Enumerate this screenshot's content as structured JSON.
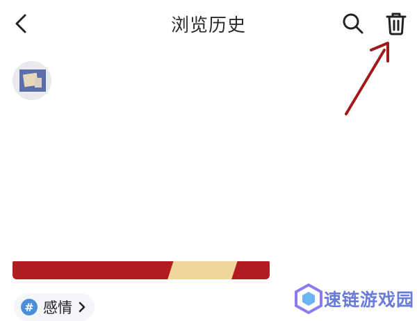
{
  "header": {
    "title": "浏览历史",
    "back_icon": "chevron-left-icon",
    "search_icon": "search-icon",
    "trash_icon": "trash-icon"
  },
  "feed": {
    "tag_label": "感情",
    "tag_symbol": "#"
  },
  "watermark": {
    "text": "速链游戏园"
  },
  "colors": {
    "banner_red": "#b21b1f",
    "annotation_arrow": "#a11a1a",
    "tag_icon_blue": "#4a8fd8",
    "watermark_blue": "#6a7bd9"
  }
}
